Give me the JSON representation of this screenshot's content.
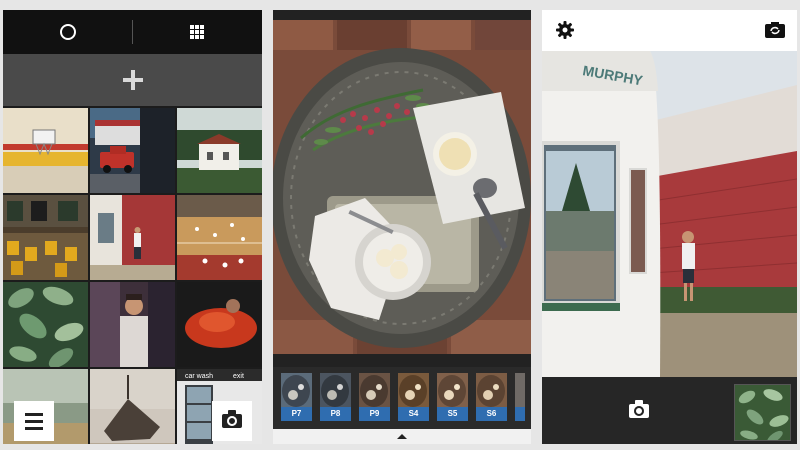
{
  "library": {
    "tabs": [
      {
        "icon": "circle-icon"
      },
      {
        "icon": "grid-icon"
      }
    ],
    "add_icon": "plus-icon",
    "menu_icon": "hamburger-icon",
    "camera_icon": "camera-icon",
    "grid_photos": [
      "striped-wall-basketball-hoop",
      "red-truck-street",
      "white-house-trees",
      "cafe-yellow-chairs",
      "man-by-red-wall",
      "basketball-court",
      "green-leaves",
      "man-portrait",
      "red-sofa-person",
      "beach-horizon",
      "wrecked-boat-beach",
      "car-wash-sign"
    ],
    "car_wash_sign": {
      "line1": "car wash",
      "line2": "exit"
    }
  },
  "editor": {
    "photo": "tray-ice-cream-overhead",
    "filters": [
      {
        "label": "P7",
        "tone": "#5b6b7a"
      },
      {
        "label": "P8",
        "tone": "#4c5560"
      },
      {
        "label": "P9",
        "tone": "#6a5344"
      },
      {
        "label": "S4",
        "tone": "#7a5a3c"
      },
      {
        "label": "S5",
        "tone": "#80604a"
      },
      {
        "label": "S6",
        "tone": "#7c5c44"
      }
    ],
    "handle_icon": "chevron-up-icon"
  },
  "camera": {
    "settings_icon": "gear-icon",
    "flip_icon": "flip-camera-icon",
    "shutter_icon": "camera-icon",
    "viewfinder": "man-by-red-building",
    "storefront_sign": "MURPHY",
    "recent_photo": "green-plants"
  },
  "colors": {
    "filter_label_bg": "#2f6db0",
    "dark_bar": "#111111",
    "add_bar": "#4a4a4a",
    "barn_red": "#a83a3c"
  }
}
